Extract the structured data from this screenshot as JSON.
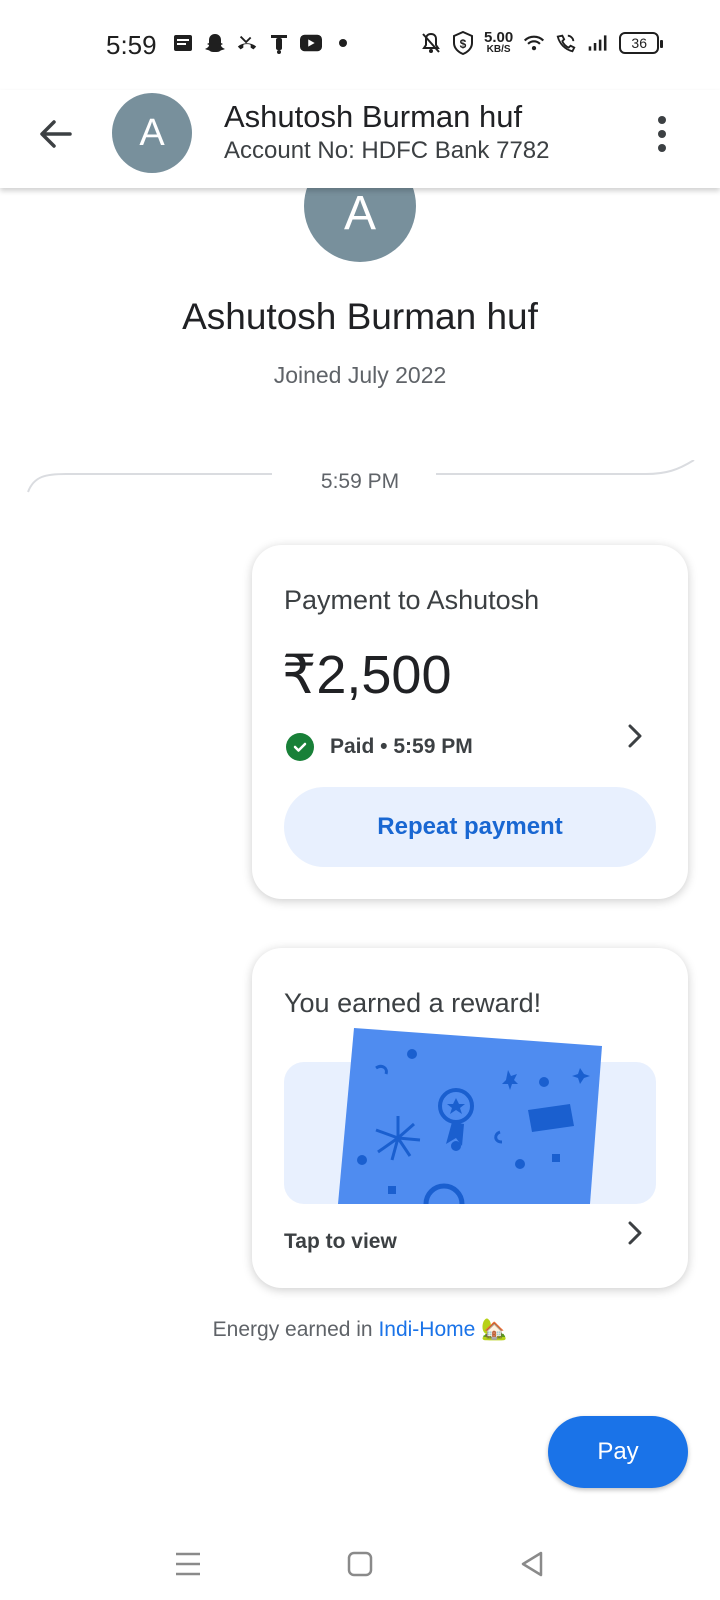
{
  "status_bar": {
    "time": "5:59",
    "net_speed_value": "5.00",
    "net_speed_unit": "KB/S",
    "battery": "36",
    "icons_left": [
      "message-icon",
      "snapchat-icon",
      "missed-call-icon",
      "bike-icon",
      "youtube-icon",
      "dot-icon"
    ],
    "icons_right": [
      "mute-bell-icon",
      "shield-dollar-icon",
      "wifi-icon",
      "wifi-call-icon",
      "signal-icon",
      "battery-icon"
    ]
  },
  "header": {
    "avatar_letter": "A",
    "title": "Ashutosh Burman huf",
    "subtitle": "Account No: HDFC Bank 7782"
  },
  "profile": {
    "avatar_letter": "A",
    "name": "Ashutosh Burman huf",
    "joined": "Joined July 2022"
  },
  "timeline": {
    "time": "5:59 PM"
  },
  "payment_card": {
    "title": "Payment to Ashutosh",
    "amount": "₹2,500",
    "status": "Paid • 5:59 PM",
    "repeat_label": "Repeat payment"
  },
  "reward_card": {
    "title": "You earned a reward!",
    "cta": "Tap to view"
  },
  "energy": {
    "prefix": "Energy earned in ",
    "link": "Indi-Home",
    "emoji": "🏡"
  },
  "pay_button": {
    "label": "Pay"
  },
  "colors": {
    "accent": "#1a73e8",
    "avatar": "#78909c",
    "success": "#188038",
    "button_tint": "#e8f0fe",
    "reward_card": "#4f8cf0"
  }
}
